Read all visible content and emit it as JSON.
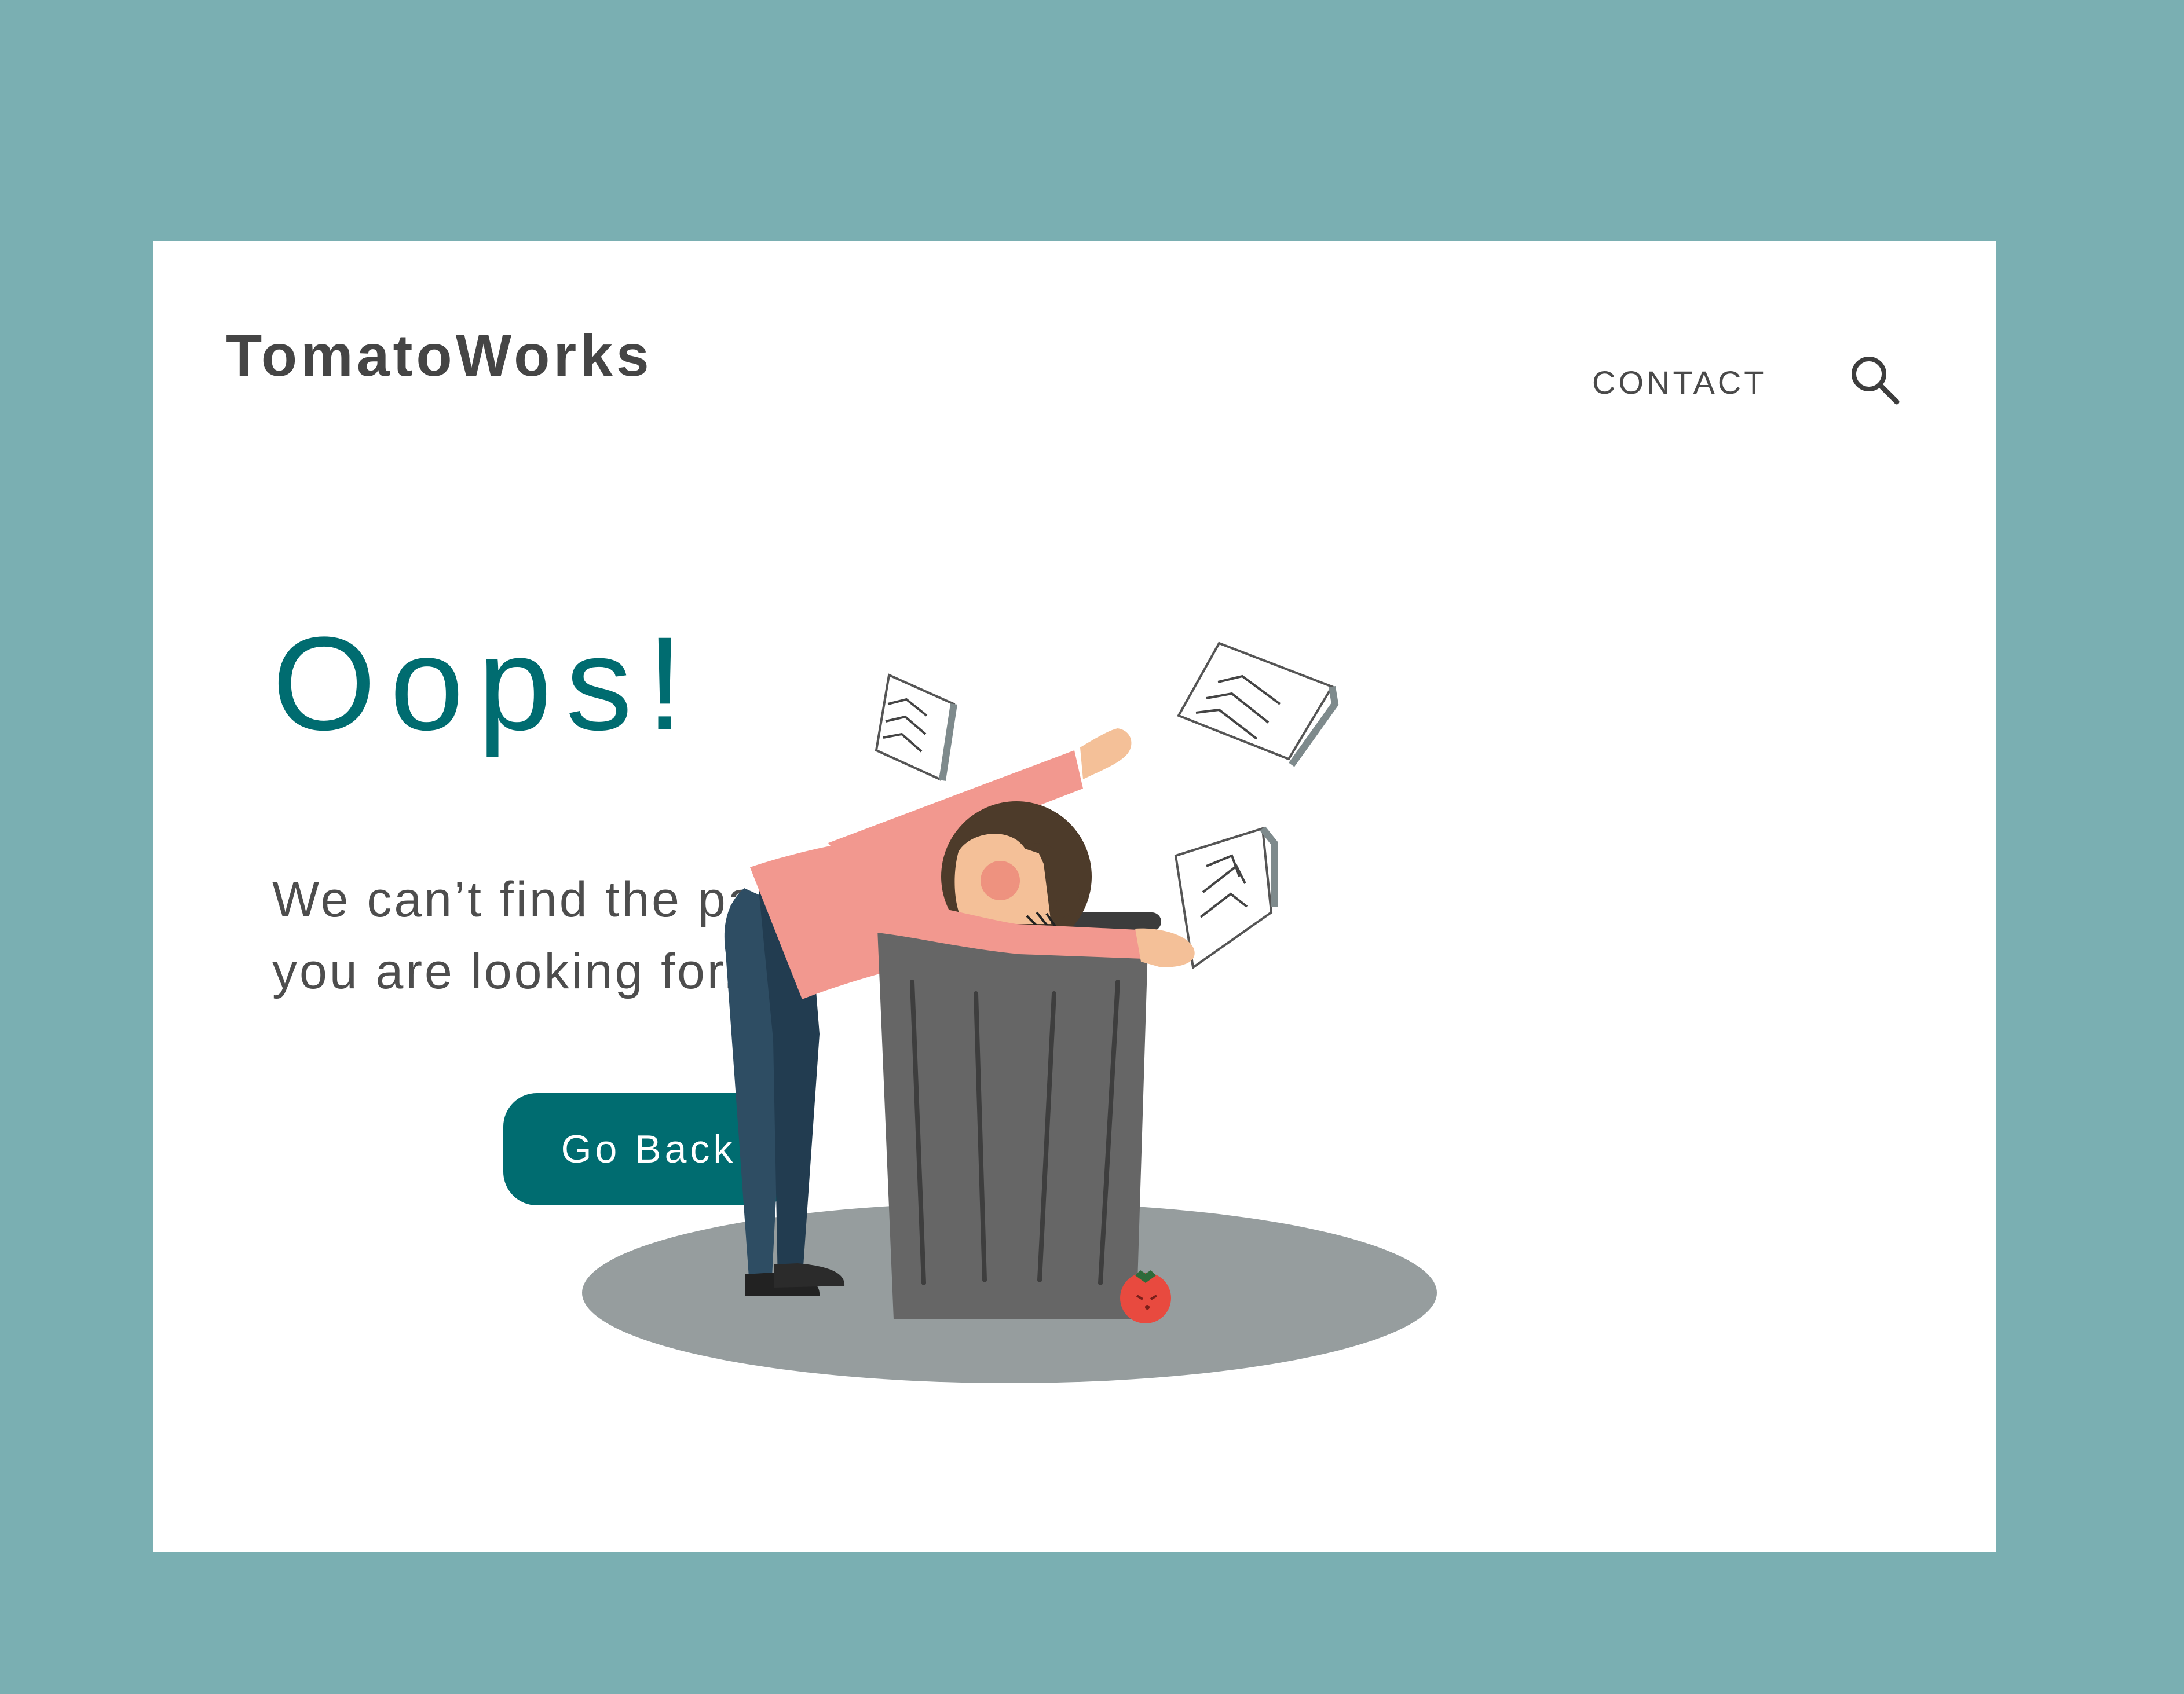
{
  "header": {
    "logo": "TomatoWorks",
    "nav_contact": "CONTACT",
    "search_icon": "search-icon"
  },
  "main": {
    "headline": "Oops!",
    "message": "We can’t find the page you are looking for.",
    "back_button_label": "Go Back"
  },
  "illustration": {
    "subject": "person-leaning-on-trash-can",
    "icons": [
      "paper-sheet-icon",
      "tomato-icon",
      "trash-can-icon"
    ]
  },
  "colors": {
    "frame_background": "#7aafb2",
    "card_background": "#ffffff",
    "accent": "#006c70",
    "logo_text": "#454545",
    "body_text": "#4d4d4d",
    "shirt": "#f2988f",
    "pants": "#2e4d63",
    "trash_can": "#666666",
    "shadow": "#969d9e",
    "tomato": "#e84a3f"
  }
}
